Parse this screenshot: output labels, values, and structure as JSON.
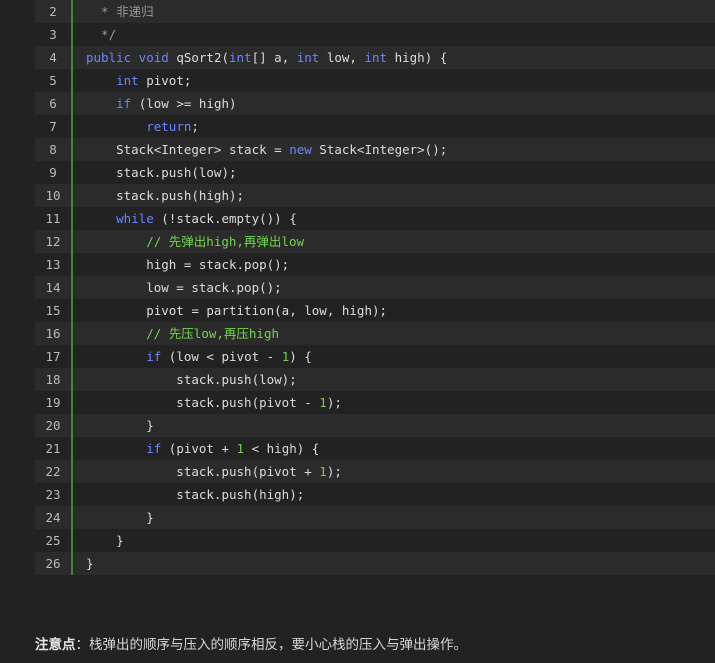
{
  "code": {
    "lines": [
      {
        "num": "2",
        "tokens": [
          {
            "t": "  * 非递归",
            "c": "doc"
          }
        ]
      },
      {
        "num": "3",
        "tokens": [
          {
            "t": "  */",
            "c": "doc"
          }
        ]
      },
      {
        "num": "4",
        "tokens": [
          {
            "t": "public void",
            "c": "kw"
          },
          {
            "t": " qSort2(",
            "c": ""
          },
          {
            "t": "int",
            "c": "kw"
          },
          {
            "t": "[] a, ",
            "c": ""
          },
          {
            "t": "int",
            "c": "kw"
          },
          {
            "t": " low, ",
            "c": ""
          },
          {
            "t": "int",
            "c": "kw"
          },
          {
            "t": " high) {",
            "c": ""
          }
        ]
      },
      {
        "num": "5",
        "tokens": [
          {
            "t": "    ",
            "c": ""
          },
          {
            "t": "int",
            "c": "kw"
          },
          {
            "t": " pivot;",
            "c": ""
          }
        ]
      },
      {
        "num": "6",
        "tokens": [
          {
            "t": "    ",
            "c": ""
          },
          {
            "t": "if",
            "c": "kw"
          },
          {
            "t": " (low >= high)",
            "c": ""
          }
        ]
      },
      {
        "num": "7",
        "tokens": [
          {
            "t": "        ",
            "c": ""
          },
          {
            "t": "return",
            "c": "kw"
          },
          {
            "t": ";",
            "c": ""
          }
        ]
      },
      {
        "num": "8",
        "tokens": [
          {
            "t": "    Stack<Integer> stack = ",
            "c": ""
          },
          {
            "t": "new",
            "c": "kw"
          },
          {
            "t": " Stack<Integer>();",
            "c": ""
          }
        ]
      },
      {
        "num": "9",
        "tokens": [
          {
            "t": "    stack.push(low);",
            "c": ""
          }
        ]
      },
      {
        "num": "10",
        "tokens": [
          {
            "t": "    stack.push(high);",
            "c": ""
          }
        ]
      },
      {
        "num": "11",
        "tokens": [
          {
            "t": "    ",
            "c": ""
          },
          {
            "t": "while",
            "c": "kw"
          },
          {
            "t": " (!stack.empty()) {",
            "c": ""
          }
        ]
      },
      {
        "num": "12",
        "tokens": [
          {
            "t": "        ",
            "c": ""
          },
          {
            "t": "// 先弹出high,再弹出low",
            "c": "cm"
          }
        ]
      },
      {
        "num": "13",
        "tokens": [
          {
            "t": "        high = stack.pop();",
            "c": ""
          }
        ]
      },
      {
        "num": "14",
        "tokens": [
          {
            "t": "        low = stack.pop();",
            "c": ""
          }
        ]
      },
      {
        "num": "15",
        "tokens": [
          {
            "t": "        pivot = partition(a, low, high);",
            "c": ""
          }
        ]
      },
      {
        "num": "16",
        "tokens": [
          {
            "t": "        ",
            "c": ""
          },
          {
            "t": "// 先压low,再压high",
            "c": "cm"
          }
        ]
      },
      {
        "num": "17",
        "tokens": [
          {
            "t": "        ",
            "c": ""
          },
          {
            "t": "if",
            "c": "kw"
          },
          {
            "t": " (low < pivot - ",
            "c": ""
          },
          {
            "t": "1",
            "c": "num"
          },
          {
            "t": ") {",
            "c": ""
          }
        ]
      },
      {
        "num": "18",
        "tokens": [
          {
            "t": "            stack.push(low);",
            "c": ""
          }
        ]
      },
      {
        "num": "19",
        "tokens": [
          {
            "t": "            stack.push(pivot - ",
            "c": ""
          },
          {
            "t": "1",
            "c": "num"
          },
          {
            "t": ");",
            "c": ""
          }
        ]
      },
      {
        "num": "20",
        "tokens": [
          {
            "t": "        }",
            "c": ""
          }
        ]
      },
      {
        "num": "21",
        "tokens": [
          {
            "t": "        ",
            "c": ""
          },
          {
            "t": "if",
            "c": "kw"
          },
          {
            "t": " (pivot + ",
            "c": ""
          },
          {
            "t": "1",
            "c": "num"
          },
          {
            "t": " < high) {",
            "c": ""
          }
        ]
      },
      {
        "num": "22",
        "tokens": [
          {
            "t": "            stack.push(pivot + ",
            "c": ""
          },
          {
            "t": "1",
            "c": "num"
          },
          {
            "t": ");",
            "c": ""
          }
        ]
      },
      {
        "num": "23",
        "tokens": [
          {
            "t": "            stack.push(high);",
            "c": ""
          }
        ]
      },
      {
        "num": "24",
        "tokens": [
          {
            "t": "        }",
            "c": ""
          }
        ]
      },
      {
        "num": "25",
        "tokens": [
          {
            "t": "    }",
            "c": ""
          }
        ]
      },
      {
        "num": "26",
        "tokens": [
          {
            "t": "}",
            "c": ""
          }
        ]
      }
    ]
  },
  "note": {
    "label": "注意点",
    "separator": "：",
    "text": "栈弹出的顺序与压入的顺序相反，要小心栈的压入与弹出操作。"
  },
  "colors": {
    "background": "#222222",
    "keyword": "#6a86ff",
    "comment": "#73d64c",
    "number": "#74d04a",
    "gutter": "#3c8a2e"
  }
}
